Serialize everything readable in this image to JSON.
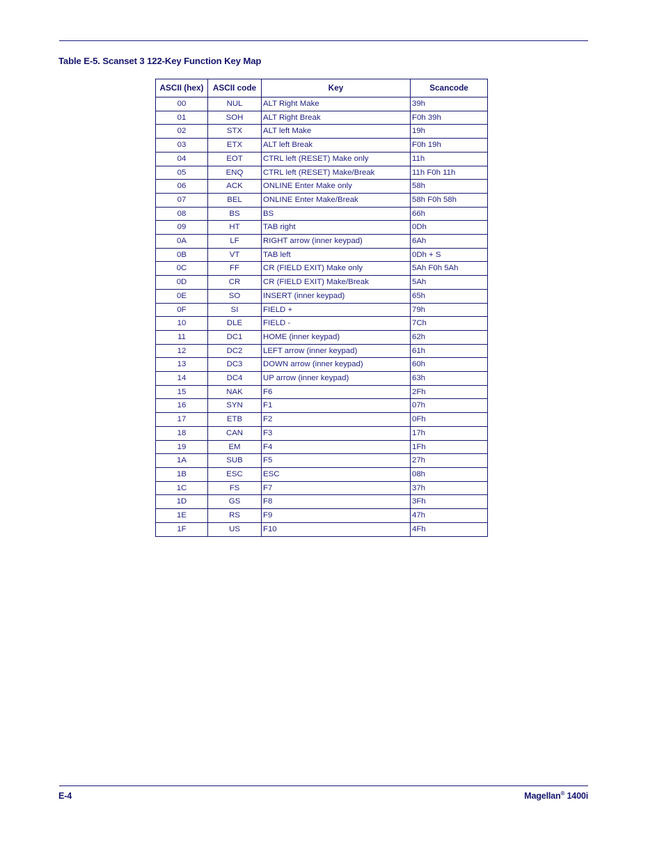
{
  "document": {
    "table_caption": "Table E-5. Scanset 3 122-Key Function Key Map"
  },
  "table": {
    "headers": [
      "ASCII (hex)",
      "ASCII code",
      "Key",
      "Scancode"
    ],
    "rows": [
      [
        "00",
        "NUL",
        "ALT Right Make",
        "39h"
      ],
      [
        "01",
        "SOH",
        "ALT Right Break",
        "F0h 39h"
      ],
      [
        "02",
        "STX",
        "ALT left Make",
        "19h"
      ],
      [
        "03",
        "ETX",
        "ALT left Break",
        "F0h 19h"
      ],
      [
        "04",
        "EOT",
        "CTRL left (RESET) Make only",
        "11h"
      ],
      [
        "05",
        "ENQ",
        "CTRL left (RESET) Make/Break",
        "11h F0h 11h"
      ],
      [
        "06",
        "ACK",
        "ONLINE Enter Make only",
        "58h"
      ],
      [
        "07",
        "BEL",
        "ONLINE Enter Make/Break",
        "58h F0h 58h"
      ],
      [
        "08",
        "BS",
        "BS",
        "66h"
      ],
      [
        "09",
        "HT",
        "TAB right",
        "0Dh"
      ],
      [
        "0A",
        "LF",
        "RIGHT arrow (inner keypad)",
        "6Ah"
      ],
      [
        "0B",
        "VT",
        "TAB left",
        "0Dh + S"
      ],
      [
        "0C",
        "FF",
        "CR (FIELD EXIT) Make only",
        "5Ah F0h 5Ah"
      ],
      [
        "0D",
        "CR",
        "CR (FIELD EXIT) Make/Break",
        "5Ah"
      ],
      [
        "0E",
        "SO",
        "INSERT (inner keypad)",
        "65h"
      ],
      [
        "0F",
        "SI",
        "FIELD +",
        "79h"
      ],
      [
        "10",
        "DLE",
        "FIELD -",
        "7Ch"
      ],
      [
        "11",
        "DC1",
        "HOME (inner keypad)",
        "62h"
      ],
      [
        "12",
        "DC2",
        "LEFT arrow (inner keypad)",
        "61h"
      ],
      [
        "13",
        "DC3",
        "DOWN arrow (inner keypad)",
        "60h"
      ],
      [
        "14",
        "DC4",
        "UP arrow (inner keypad)",
        "63h"
      ],
      [
        "15",
        "NAK",
        "F6",
        "2Fh"
      ],
      [
        "16",
        "SYN",
        "F1",
        "07h"
      ],
      [
        "17",
        "ETB",
        "F2",
        "0Fh"
      ],
      [
        "18",
        "CAN",
        "F3",
        "17h"
      ],
      [
        "19",
        "EM",
        "F4",
        "1Fh"
      ],
      [
        "1A",
        "SUB",
        "F5",
        "27h"
      ],
      [
        "1B",
        "ESC",
        "ESC",
        "08h"
      ],
      [
        "1C",
        "FS",
        "F7",
        "37h"
      ],
      [
        "1D",
        "GS",
        "F8",
        "3Fh"
      ],
      [
        "1E",
        "RS",
        "F9",
        "47h"
      ],
      [
        "1F",
        "US",
        "F10",
        "4Fh"
      ]
    ]
  },
  "footer": {
    "page_number": "E-4",
    "product_name": "Magellan",
    "product_mark": "®",
    "product_model": "1400i"
  },
  "colors": {
    "text": "#1a1a7a",
    "heading": "#16166e",
    "border": "#16166e",
    "background": "#ffffff"
  }
}
